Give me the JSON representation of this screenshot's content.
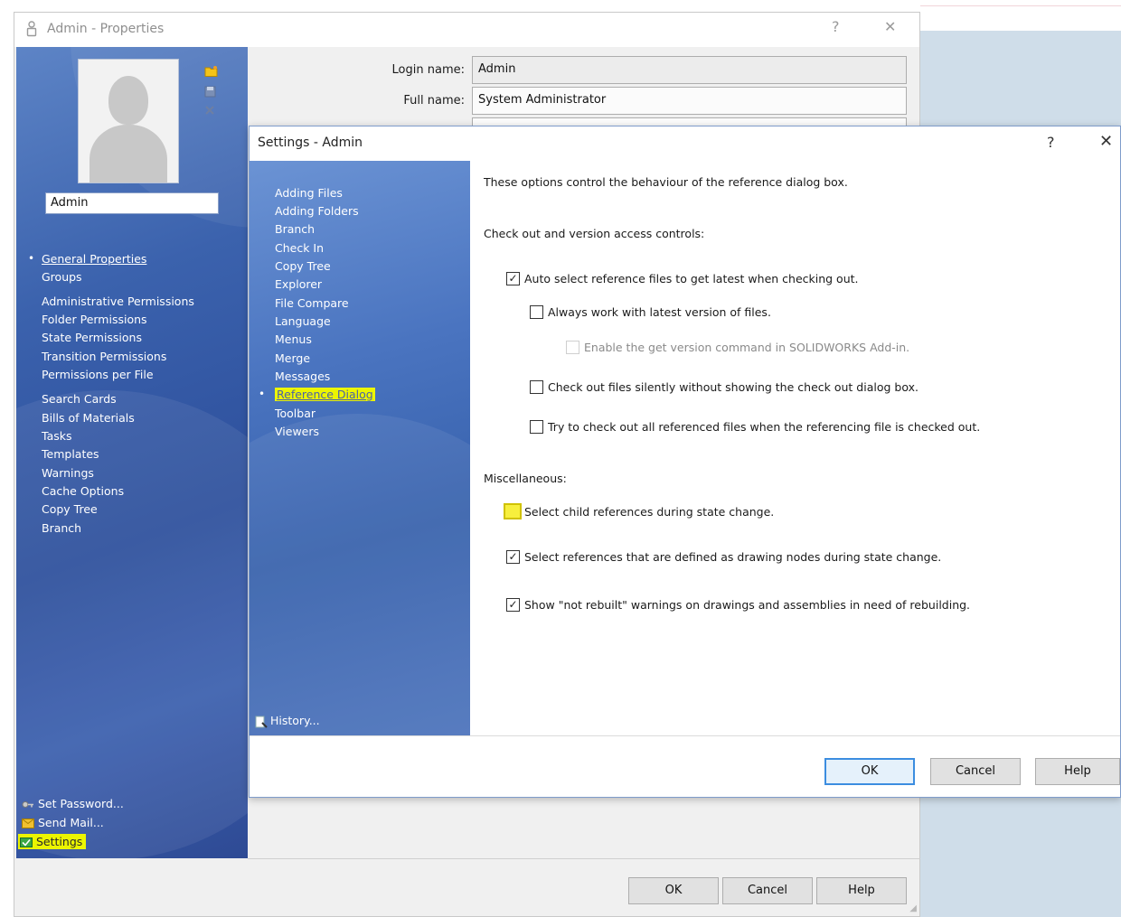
{
  "properties_window": {
    "title": "Admin - Properties",
    "help_glyph": "?",
    "close_glyph": "✕",
    "user_name": "Admin",
    "login_label": "Login name:",
    "login_value": "Admin",
    "fullname_label": "Full name:",
    "fullname_value": "System Administrator",
    "nav": [
      {
        "label": "General Properties",
        "selected": true
      },
      {
        "label": "Groups"
      },
      {
        "label": "Administrative Permissions"
      },
      {
        "label": "Folder Permissions"
      },
      {
        "label": "State Permissions"
      },
      {
        "label": "Transition Permissions"
      },
      {
        "label": "Permissions per File"
      },
      {
        "label": "Search Cards"
      },
      {
        "label": "Bills of Materials"
      },
      {
        "label": "Tasks"
      },
      {
        "label": "Templates"
      },
      {
        "label": "Warnings"
      },
      {
        "label": "Cache Options"
      },
      {
        "label": "Copy Tree"
      },
      {
        "label": "Branch"
      }
    ],
    "bottom_links": {
      "set_password": "Set Password...",
      "send_mail": "Send Mail...",
      "settings": "Settings"
    },
    "buttons": {
      "ok": "OK",
      "cancel": "Cancel",
      "help": "Help"
    }
  },
  "settings_dialog": {
    "title": "Settings - Admin",
    "help_glyph": "?",
    "close_glyph": "✕",
    "nav": [
      "Adding Files",
      "Adding Folders",
      "Branch",
      "Check In",
      "Copy Tree",
      "Explorer",
      "File Compare",
      "Language",
      "Menus",
      "Merge",
      "Messages",
      "Reference Dialog",
      "Toolbar",
      "Viewers"
    ],
    "selected_nav": "Reference Dialog",
    "history_label": "History...",
    "intro": "These options control the behaviour of the reference dialog box.",
    "section1": "Check out and version access controls:",
    "options1": {
      "auto_select": {
        "label": "Auto select reference files to get latest when checking out.",
        "checked": true
      },
      "always_latest": {
        "label": "Always work with latest version of files.",
        "checked": false
      },
      "enable_get_version": {
        "label": "Enable the get version command in SOLIDWORKS Add-in.",
        "checked": false,
        "enabled": false
      },
      "silent_checkout": {
        "label": "Check out files silently without showing the check out dialog box.",
        "checked": false
      },
      "try_checkout_all": {
        "label": "Try to check out all referenced files when the referencing file is checked out.",
        "checked": false
      }
    },
    "section2": "Miscellaneous:",
    "options2": {
      "child_refs": {
        "label": "Select child references during state change.",
        "checked": false
      },
      "drawing_nodes": {
        "label": "Select references that are defined as drawing nodes during state change.",
        "checked": true
      },
      "not_rebuilt": {
        "label": "Show \"not rebuilt\" warnings on drawings and assemblies in need of rebuilding.",
        "checked": true
      }
    },
    "check_glyph": "✓",
    "buttons": {
      "ok": "OK",
      "cancel": "Cancel",
      "help": "Help"
    }
  },
  "colors": {
    "highlight": "#ecf500",
    "nav_blue": "#3b62ad",
    "default_button_border": "#3c8de0"
  }
}
